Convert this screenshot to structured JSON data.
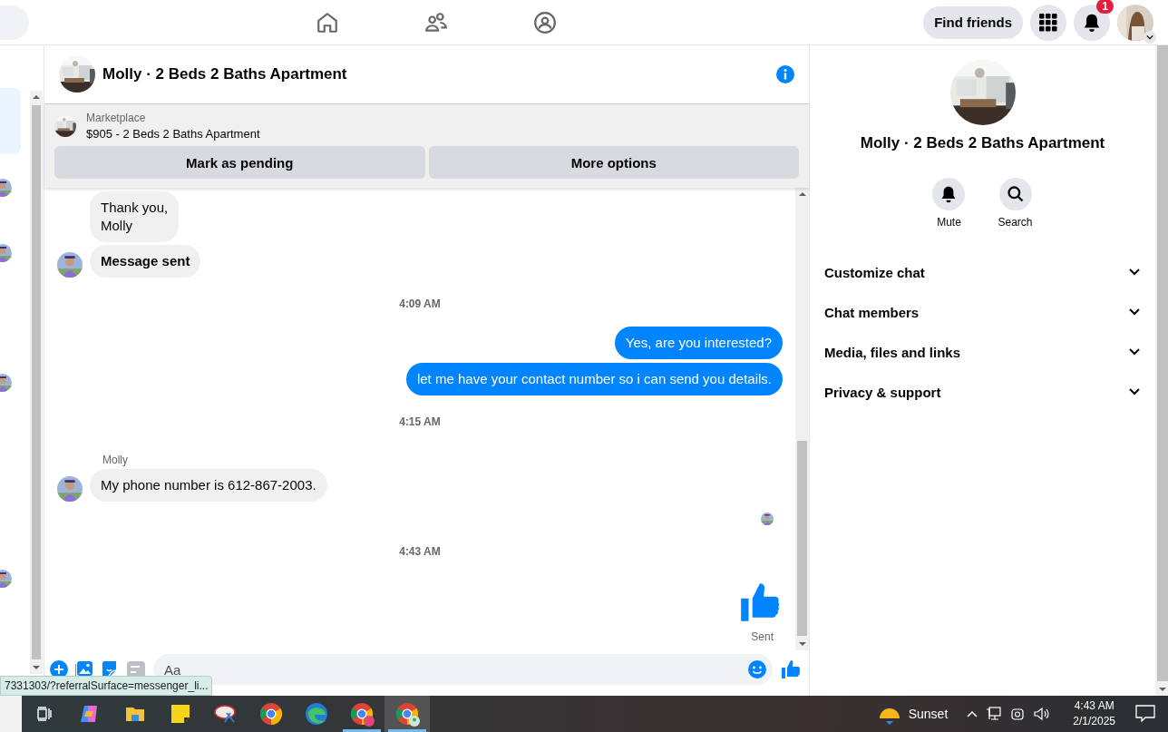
{
  "top_bar": {
    "find_friends": "Find friends",
    "notification_count": "1"
  },
  "chat": {
    "title": "Molly · 2 Beds 2 Baths Apartment",
    "listing": {
      "source": "Marketplace",
      "title": "$905 - 2 Beds 2 Baths Apartment"
    },
    "actions": [
      "Mark as pending",
      "More options"
    ],
    "messages": [
      {
        "kind": "incoming",
        "text": "Thank you,\nMolly",
        "avatar": false
      },
      {
        "kind": "notice",
        "text": "Message sent",
        "avatar": true
      },
      {
        "kind": "time",
        "text": "4:09 AM"
      },
      {
        "kind": "outgoing",
        "text": "Yes, are you interested?"
      },
      {
        "kind": "outgoing",
        "text": "let me have your contact number so i can send you details."
      },
      {
        "kind": "time",
        "text": "4:15 AM"
      },
      {
        "kind": "sender",
        "text": "Molly"
      },
      {
        "kind": "incoming",
        "text": "My phone number is 612-867-2003.",
        "avatar": true
      },
      {
        "kind": "seen"
      },
      {
        "kind": "time",
        "text": "4:43 AM"
      },
      {
        "kind": "like"
      },
      {
        "kind": "status",
        "text": "Sent"
      }
    ],
    "composer": {
      "placeholder": "Aa"
    }
  },
  "details": {
    "title": "Molly · 2 Beds 2 Baths Apartment",
    "actions": [
      {
        "kind": "mute",
        "label": "Mute"
      },
      {
        "kind": "search",
        "label": "Search"
      }
    ],
    "sections": [
      {
        "label": "Customize chat",
        "expanded": false
      },
      {
        "label": "Chat members",
        "expanded": false
      },
      {
        "label": "Media, files and links",
        "expanded": false
      },
      {
        "label": "Privacy & support",
        "expanded": false
      }
    ]
  },
  "status_url": "7331303/?referralSurface=messenger_li...",
  "taskbar": {
    "weather": "Sunset",
    "time": "4:43 AM",
    "date": "2/1/2025"
  }
}
